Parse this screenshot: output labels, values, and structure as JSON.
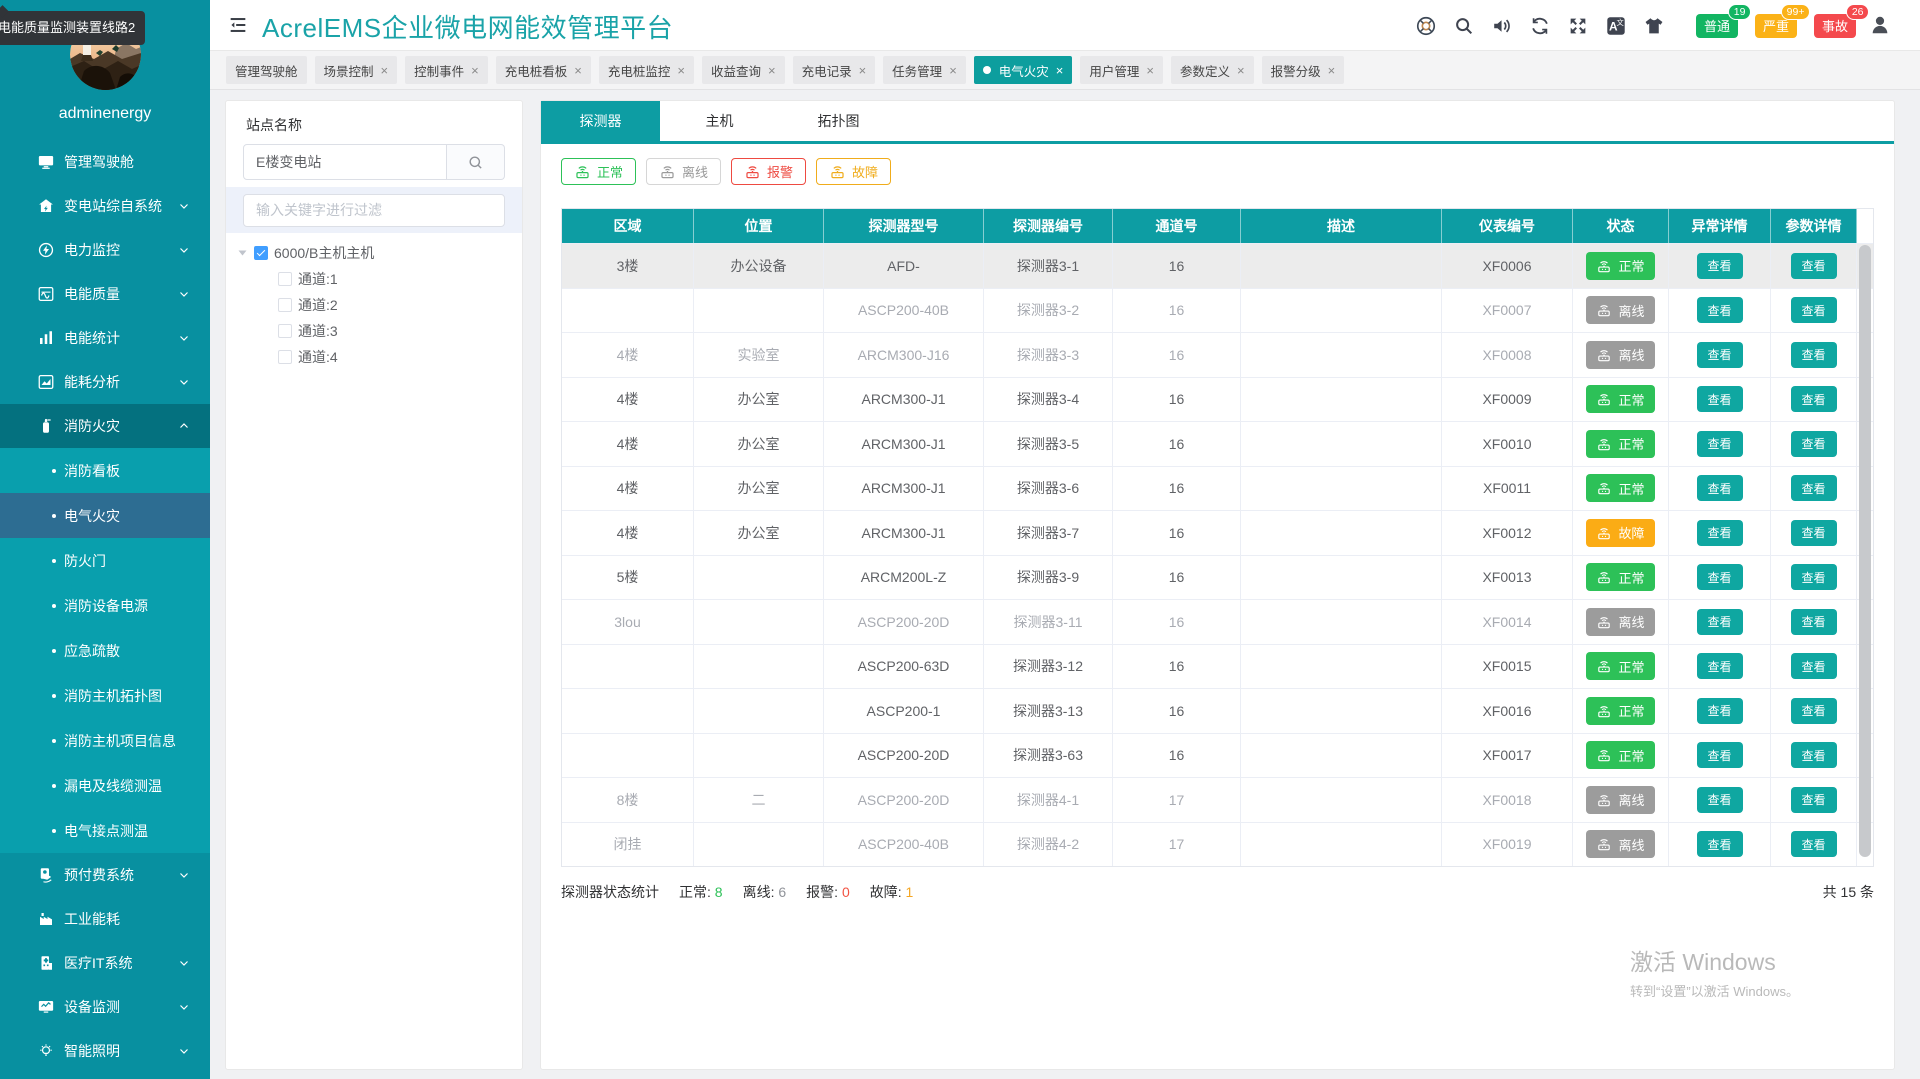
{
  "tooltip": {
    "text": "电能质量监测装置线路2"
  },
  "sidebar": {
    "username": "adminenergy",
    "active_submenu": "电气火灾",
    "items": [
      {
        "label": "管理驾驶舱",
        "icon": "dashboard-icon",
        "chevron": "none"
      },
      {
        "label": "变电站综自系统",
        "icon": "substation-icon",
        "chevron": "down"
      },
      {
        "label": "电力监控",
        "icon": "power-monitor-icon",
        "chevron": "down"
      },
      {
        "label": "电能质量",
        "icon": "power-quality-icon",
        "chevron": "down"
      },
      {
        "label": "电能统计",
        "icon": "energy-stats-icon",
        "chevron": "down"
      },
      {
        "label": "能耗分析",
        "icon": "energy-analysis-icon",
        "chevron": "down"
      },
      {
        "label": "消防火灾",
        "icon": "fire-icon",
        "chevron": "up",
        "expanded": true,
        "children": [
          "消防看板",
          "电气火灾",
          "防火门",
          "消防设备电源",
          "应急疏散",
          "消防主机拓扑图",
          "消防主机项目信息",
          "漏电及线缆测温",
          "电气接点测温"
        ]
      },
      {
        "label": "预付费系统",
        "icon": "prepaid-icon",
        "chevron": "down"
      },
      {
        "label": "工业能耗",
        "icon": "industry-icon",
        "chevron": "none"
      },
      {
        "label": "医疗IT系统",
        "icon": "medical-icon",
        "chevron": "down"
      },
      {
        "label": "设备监测",
        "icon": "device-monitor-icon",
        "chevron": "down"
      },
      {
        "label": "智能照明",
        "icon": "lighting-icon",
        "chevron": "down"
      }
    ]
  },
  "header": {
    "title": "AcrelEMS企业微电网能效管理平台",
    "icons": [
      "help-icon",
      "search-icon",
      "volume-icon",
      "refresh-icon",
      "fullscreen-icon",
      "translate-icon",
      "theme-icon"
    ],
    "alarm_buttons": [
      {
        "label": "普通",
        "count": "19",
        "color": "#12b562"
      },
      {
        "label": "严重",
        "count": "99+",
        "color": "#fbb217"
      },
      {
        "label": "事故",
        "count": "26",
        "color": "#f4494d"
      }
    ]
  },
  "tab_bar": {
    "tabs": [
      {
        "label": "管理驾驶舱",
        "closable": false,
        "active": false
      },
      {
        "label": "场景控制",
        "closable": true,
        "active": false
      },
      {
        "label": "控制事件",
        "closable": true,
        "active": false
      },
      {
        "label": "充电桩看板",
        "closable": true,
        "active": false
      },
      {
        "label": "充电桩监控",
        "closable": true,
        "active": false
      },
      {
        "label": "收益查询",
        "closable": true,
        "active": false
      },
      {
        "label": "充电记录",
        "closable": true,
        "active": false
      },
      {
        "label": "任务管理",
        "closable": true,
        "active": false
      },
      {
        "label": "电气火灾",
        "closable": true,
        "active": true
      },
      {
        "label": "用户管理",
        "closable": true,
        "active": false
      },
      {
        "label": "参数定义",
        "closable": true,
        "active": false
      },
      {
        "label": "报警分级",
        "closable": true,
        "active": false
      }
    ]
  },
  "station_panel": {
    "label": "站点名称",
    "station_value": "E楼变电站",
    "filter_placeholder": "输入关键字进行过滤",
    "tree": {
      "root": "6000/B主机主机",
      "root_checked": true,
      "children": [
        "通道:1",
        "通道:2",
        "通道:3",
        "通道:4"
      ]
    }
  },
  "detector_panel": {
    "tabs": [
      "探测器",
      "主机",
      "拓扑图"
    ],
    "active_tab": "探测器",
    "filters": [
      {
        "label": "正常",
        "color": "#2dc158"
      },
      {
        "label": "离线",
        "color": "#9a9a9a",
        "border": "#d6d6d6"
      },
      {
        "label": "报警",
        "color": "#ee4a41"
      },
      {
        "label": "故障",
        "color": "#f0ac1b"
      }
    ],
    "table": {
      "columns": [
        "区域",
        "位置",
        "探测器型号",
        "探测器编号",
        "通道号",
        "描述",
        "仪表编号",
        "状态",
        "异常详情",
        "参数详情"
      ],
      "view_label": "查看",
      "rows": [
        {
          "area": "3楼",
          "location": "办公设备",
          "model": "AFD-",
          "code": "探测器3-1",
          "channel": "16",
          "desc": "",
          "meter": "XF0006",
          "status": "正常",
          "state": "normal",
          "current": true
        },
        {
          "area": "",
          "location": "",
          "model": "ASCP200-40B",
          "code": "探测器3-2",
          "channel": "16",
          "desc": "",
          "meter": "XF0007",
          "status": "离线",
          "state": "offline",
          "current": false
        },
        {
          "area": "4楼",
          "location": "实验室",
          "model": "ARCM300-J16",
          "code": "探测器3-3",
          "channel": "16",
          "desc": "",
          "meter": "XF0008",
          "status": "离线",
          "state": "offline",
          "current": false
        },
        {
          "area": "4楼",
          "location": "办公室",
          "model": "ARCM300-J1",
          "code": "探测器3-4",
          "channel": "16",
          "desc": "",
          "meter": "XF0009",
          "status": "正常",
          "state": "normal",
          "current": false
        },
        {
          "area": "4楼",
          "location": "办公室",
          "model": "ARCM300-J1",
          "code": "探测器3-5",
          "channel": "16",
          "desc": "",
          "meter": "XF0010",
          "status": "正常",
          "state": "normal",
          "current": false
        },
        {
          "area": "4楼",
          "location": "办公室",
          "model": "ARCM300-J1",
          "code": "探测器3-6",
          "channel": "16",
          "desc": "",
          "meter": "XF0011",
          "status": "正常",
          "state": "normal",
          "current": false
        },
        {
          "area": "4楼",
          "location": "办公室",
          "model": "ARCM300-J1",
          "code": "探测器3-7",
          "channel": "16",
          "desc": "",
          "meter": "XF0012",
          "status": "故障",
          "state": "fault",
          "current": false
        },
        {
          "area": "5楼",
          "location": "",
          "model": "ARCM200L-Z",
          "code": "探测器3-9",
          "channel": "16",
          "desc": "",
          "meter": "XF0013",
          "status": "正常",
          "state": "normal",
          "current": false
        },
        {
          "area": "3lou",
          "location": "",
          "model": "ASCP200-20D",
          "code": "探测器3-11",
          "channel": "16",
          "desc": "",
          "meter": "XF0014",
          "status": "离线",
          "state": "offline",
          "current": false
        },
        {
          "area": "",
          "location": "",
          "model": "ASCP200-63D",
          "code": "探测器3-12",
          "channel": "16",
          "desc": "",
          "meter": "XF0015",
          "status": "正常",
          "state": "normal",
          "current": false
        },
        {
          "area": "",
          "location": "",
          "model": "ASCP200-1",
          "code": "探测器3-13",
          "channel": "16",
          "desc": "",
          "meter": "XF0016",
          "status": "正常",
          "state": "normal",
          "current": false
        },
        {
          "area": "",
          "location": "",
          "model": "ASCP200-20D",
          "code": "探测器3-63",
          "channel": "16",
          "desc": "",
          "meter": "XF0017",
          "status": "正常",
          "state": "normal",
          "current": false
        },
        {
          "area": "8楼",
          "location": "二",
          "model": "ASCP200-20D",
          "code": "探测器4-1",
          "channel": "17",
          "desc": "",
          "meter": "XF0018",
          "status": "离线",
          "state": "offline",
          "current": false
        },
        {
          "area": "闭挂",
          "location": "",
          "model": "ASCP200-40B",
          "code": "探测器4-2",
          "channel": "17",
          "desc": "",
          "meter": "XF0019",
          "status": "离线",
          "state": "offline",
          "current": false
        }
      ]
    },
    "summary": {
      "label": "探测器状态统计",
      "items": [
        {
          "label": "正常",
          "value": "8",
          "color": "#2dc158"
        },
        {
          "label": "离线",
          "value": "6",
          "color": "#909399"
        },
        {
          "label": "报警",
          "value": "0",
          "color": "#f25343"
        },
        {
          "label": "故障",
          "value": "1",
          "color": "#f5a623"
        }
      ],
      "total": "共 15 条"
    }
  },
  "watermark": {
    "line1": "激活 Windows",
    "line2": "转到“设置”以激活 Windows。"
  }
}
